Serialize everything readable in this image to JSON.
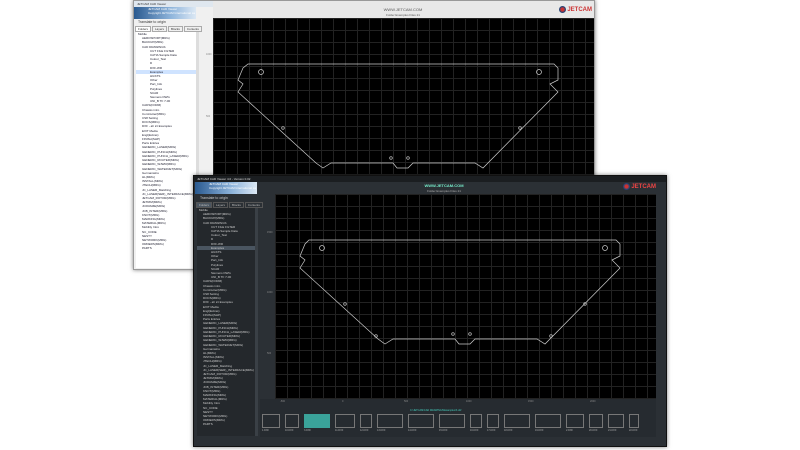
{
  "light_window": {
    "title": "JETCAM CAD Viewer",
    "banner_title": "JETCAM CAD Viewer",
    "banner_sub": "Copyright JETCAM International sa",
    "search_label": "Translate to origin",
    "tabs": [
      "Folders",
      "Layers",
      "Blocks",
      "Contents"
    ],
    "header_url": "WWW.JETCAM.COM",
    "header_info": "Folder  Examples   Files  21",
    "ruler_labels": [
      "1000",
      "500"
    ]
  },
  "dark_window": {
    "title": "JETCAM CAD Viewer 4.0 - Version 0.02",
    "banner_title": "JETCAM CAD Viewer",
    "banner_sub": "Copyright JETCAM International sa",
    "search_label": "Translate to origin",
    "tabs": [
      "Folders",
      "Layers",
      "Blocks",
      "Contents"
    ],
    "header_url": "WWW.JETCAM.COM",
    "header_info": "Folder  Examples   Files  21",
    "ruler_labels": [
      "1500",
      "1000",
      "500",
      "0"
    ],
    "x_ruler": [
      "-500",
      "0",
      "500",
      "1000",
      "1500",
      "2000"
    ],
    "selected_file": "C:\\JETCAM\\CAD DRAWINGS\\Examples\\3.dxf",
    "thumb_labels": [
      "1.DXF",
      "10.DXF",
      "3.DXF",
      "11.DXF",
      "12.DXF",
      "13.DXF",
      "14.DXF",
      "15.DXF",
      "16.DXF",
      "17.DXF",
      "18.DXF",
      "19.DXF",
      "2.DXF",
      "20.DXF",
      "21.DXF",
      "22.DXF"
    ]
  },
  "logo": "JETCAM",
  "tree": [
    "Mobile",
    "AEROSPORT(MRG)",
    "BACKUP(MRG)",
    "CAD DRAWINGS",
    "CUT FILE FILTER",
    "CATIA Sample Data",
    "Colour_Test",
    "D",
    "DXF-WR",
    "Examples",
    "HGSTS",
    "Other",
    "Part_Info",
    "Polylines",
    "SCAR",
    "Siemens DWG",
    "UNI_B TF 7-00",
    "CADS(FORM)",
    "Chassis intro",
    "ComCutter(MRG)",
    "CS8 Setting",
    "DOCS(MRG)",
    "DXF - ah ict Examples",
    "EXIT Media",
    "Engl(Extras)",
    "FINISH(SHP)",
    "Parts Entries",
    "GENERIC_LASER(MRG)",
    "GENERIC_PUNCH(MRG)",
    "GENERIC_PUNCH_LASER(MRG)",
    "GENERIC_ROUTER(MRG)",
    "GENERIC_WJWR(MRG)",
    "GENERIC_WATERJET(MRG)",
    "Germanwins",
    "HL(MRG)",
    "INSTALL(MRG)",
    "JTECH(MRG)",
    "JC_LASER_Matching",
    "JC_LASER(SER)_INTERFACE(MRG)",
    "JETCAM_ROTOR(MRG)",
    "JETRIM(MRG)",
    "JCFRAME(MRG)",
    "JCB_INTER(MRG)",
    "KNOT(MRG)",
    "MARKING(MRG)",
    "MATERIAL(MRG)",
    "Mobility Intro",
    "NC_CODE",
    "NESTY",
    "NETWORK(MRG)",
    "ORDERS(MRG)",
    "PARTS"
  ],
  "selected_index": 9
}
